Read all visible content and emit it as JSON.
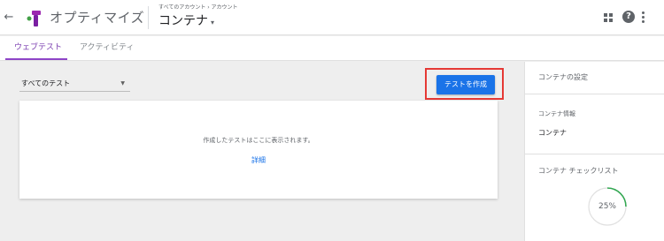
{
  "header": {
    "back_icon": "arrow-left-icon",
    "app_name": "オプティマイズ",
    "breadcrumb": "すべてのアカウント › アカウント",
    "container_title": "コンテナ",
    "container_caret": "▾",
    "icons": [
      "back-arrow-icon",
      "optimize-logo-icon",
      "apps-grid-icon",
      "help-icon",
      "more-vert-icon"
    ],
    "help_glyph": "?"
  },
  "tabs": [
    {
      "label": "ウェブテスト",
      "active": true
    },
    {
      "label": "アクティビティ",
      "active": false
    }
  ],
  "toolbar": {
    "filter_value": "すべてのテスト",
    "filter_caret": "▼",
    "create_label": "テストを作成"
  },
  "empty_state": {
    "message": "作成したテストはここに表示されます。",
    "link_label": "詳細"
  },
  "sidebar": {
    "title": "コンテナの設定",
    "info_label": "コンテナ情報",
    "info_value": "コンテナ",
    "checklist_label": "コンテナ チェックリスト",
    "progress_percent": 25,
    "progress_text": "25%"
  },
  "colors": {
    "accent": "#1a73e8",
    "tab_active": "#8e44c7",
    "highlight": "#e53935",
    "progress": "#34a853"
  }
}
